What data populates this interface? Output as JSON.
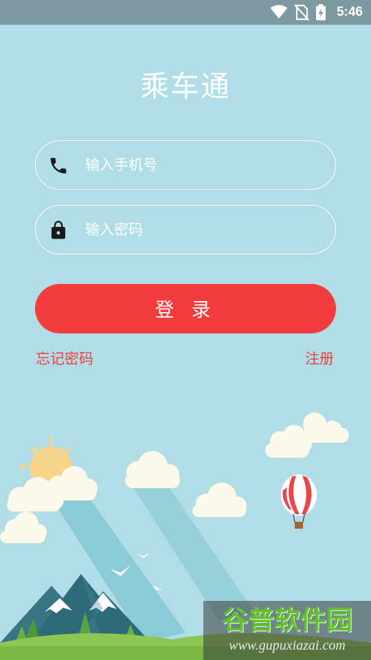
{
  "status_bar": {
    "time": "5:46",
    "icons": [
      "wifi-icon",
      "no-sim-icon",
      "battery-charging-icon"
    ]
  },
  "app": {
    "title": "乘车通"
  },
  "phone_field": {
    "icon": "phone-icon",
    "placeholder": "输入手机号",
    "value": ""
  },
  "password_field": {
    "icon": "lock-icon",
    "placeholder": "输入密码",
    "value": ""
  },
  "login_button": {
    "label": "登 录"
  },
  "links": {
    "forgot_password": "忘记密码",
    "register": "注册"
  },
  "watermark": {
    "title": "谷普软件园",
    "url": "www.gupuxiazai.com"
  },
  "colors": {
    "background": "#b0dde6",
    "accent": "#f43b3e",
    "link": "#f04040",
    "status_bar": "#7d9aa0"
  }
}
